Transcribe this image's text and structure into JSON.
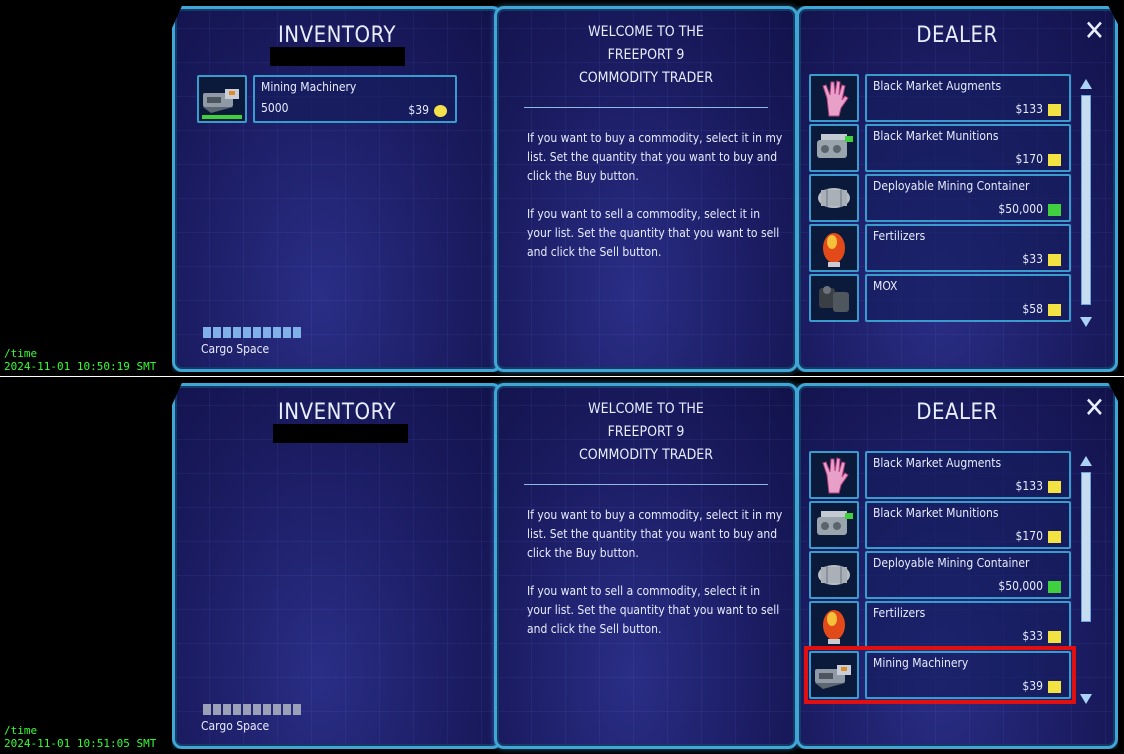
{
  "screens": [
    {
      "timestamp_cmd": "/time",
      "timestamp": "2024-11-01 10:50:19 SMT",
      "inventory": {
        "title": "INVENTORY",
        "items": [
          {
            "name": "Mining Machinery",
            "qty": "5000",
            "price": "$39",
            "icon": "mining-machinery-icon",
            "currency": "yellow-coin"
          }
        ],
        "cargo_label": "Cargo Space",
        "cargo_state": "filled"
      },
      "info": {
        "title_lines": [
          "WELCOME TO THE",
          "FREEPORT 9",
          "COMMODITY TRADER"
        ],
        "buy_text": "If you want to buy a commodity, select it in my list. Set the quantity that you want to buy and click the Buy button.",
        "sell_text": "If you want to sell a commodity, select it in your list. Set the quantity that you want to sell and click the Sell button."
      },
      "dealer": {
        "title": "DEALER",
        "close": "✕",
        "items": [
          {
            "name": "Black Market Augments",
            "price": "$133",
            "icon": "augment-hand-icon",
            "marker": "yellow"
          },
          {
            "name": "Black Market Munitions",
            "price": "$170",
            "icon": "munitions-icon",
            "marker": "yellow"
          },
          {
            "name": "Deployable Mining Container",
            "price": "$50,000",
            "icon": "mining-container-icon",
            "marker": "green"
          },
          {
            "name": "Fertilizers",
            "price": "$33",
            "icon": "fertilizer-egg-icon",
            "marker": "yellow"
          },
          {
            "name": "MOX",
            "price": "$58",
            "icon": "mox-icon",
            "marker": "yellow"
          }
        ]
      }
    },
    {
      "timestamp_cmd": "/time",
      "timestamp": "2024-11-01 10:51:05 SMT",
      "inventory": {
        "title": "INVENTORY",
        "items": [],
        "cargo_label": "Cargo Space",
        "cargo_state": "empty"
      },
      "info": {
        "title_lines": [
          "WELCOME TO THE",
          "FREEPORT 9",
          "COMMODITY TRADER"
        ],
        "buy_text": "If you want to buy a commodity, select it in my list. Set the quantity that you want to buy and click the Buy button.",
        "sell_text": "If you want to sell a commodity, select it in your list. Set the quantity that you want to sell and click the Sell button."
      },
      "dealer": {
        "title": "DEALER",
        "close": "✕",
        "items": [
          {
            "name": "Black Market Augments",
            "price": "$133",
            "icon": "augment-hand-icon",
            "marker": "yellow"
          },
          {
            "name": "Black Market Munitions",
            "price": "$170",
            "icon": "munitions-icon",
            "marker": "yellow"
          },
          {
            "name": "Deployable Mining Container",
            "price": "$50,000",
            "icon": "mining-container-icon",
            "marker": "green"
          },
          {
            "name": "Fertilizers",
            "price": "$33",
            "icon": "fertilizer-egg-icon",
            "marker": "yellow"
          },
          {
            "name": "Mining Machinery",
            "price": "$39",
            "icon": "mining-machinery-icon",
            "marker": "yellow",
            "highlighted": true
          }
        ]
      }
    }
  ],
  "colors": {
    "frame": "#3fa6d6",
    "panel_bg": "#1b1c62",
    "timestamp": "#33ff33",
    "highlight": "#e01010"
  }
}
